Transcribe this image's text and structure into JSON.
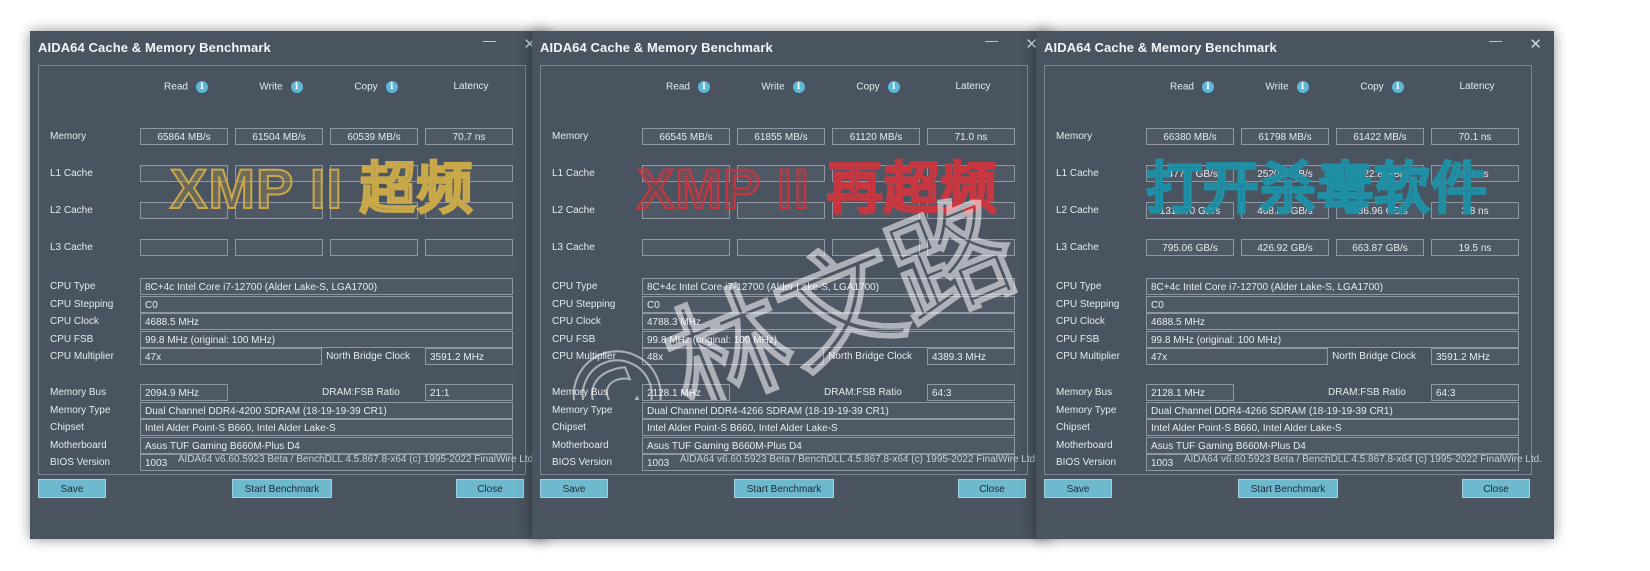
{
  "windows": [
    {
      "title": "AIDA64 Cache & Memory Benchmark",
      "overlay": "XMP II 超频",
      "headers": {
        "read": "Read",
        "write": "Write",
        "copy": "Copy",
        "latency": "Latency"
      },
      "rows": [
        {
          "label": "Memory",
          "read": "65864 MB/s",
          "write": "61504 MB/s",
          "copy": "60539 MB/s",
          "latency": "70.7 ns"
        },
        {
          "label": "L1 Cache",
          "read": "",
          "write": "",
          "copy": "",
          "latency": ""
        },
        {
          "label": "L2 Cache",
          "read": "",
          "write": "",
          "copy": "",
          "latency": ""
        },
        {
          "label": "L3 Cache",
          "read": "",
          "write": "",
          "copy": "",
          "latency": ""
        }
      ],
      "cpu_type_label": "CPU Type",
      "cpu_type": "8C+4c Intel Core i7-12700  (Alder Lake-S, LGA1700)",
      "cpu_stepping_label": "CPU Stepping",
      "cpu_stepping": "C0",
      "cpu_clock_label": "CPU Clock",
      "cpu_clock": "4688.5 MHz",
      "cpu_fsb_label": "CPU FSB",
      "cpu_fsb": "99.8 MHz  (original: 100 MHz)",
      "cpu_multiplier_label": "CPU Multiplier",
      "cpu_multiplier": "47x",
      "nb_clock_label": "North Bridge Clock",
      "nb_clock": "3591.2 MHz",
      "memory_bus_label": "Memory Bus",
      "memory_bus": "2094.9 MHz",
      "dram_ratio_label": "DRAM:FSB Ratio",
      "dram_ratio": "21:1",
      "memory_type_label": "Memory Type",
      "memory_type": "Dual Channel DDR4-4200 SDRAM  (18-19-19-39 CR1)",
      "chipset_label": "Chipset",
      "chipset": "Intel Alder Point-S B660, Intel Alder Lake-S",
      "motherboard_label": "Motherboard",
      "motherboard": "Asus TUF Gaming B660M-Plus D4",
      "bios_label": "BIOS Version",
      "bios": "1003",
      "footer": "AIDA64 v6.60.5923 Beta / BenchDLL 4.5.867.8-x64  (c) 1995-2022 FinalWire Ltd.",
      "save": "Save",
      "start": "Start Benchmark",
      "close": "Close"
    },
    {
      "title": "AIDA64 Cache & Memory Benchmark",
      "overlay": "XMP II 再超频",
      "headers": {
        "read": "Read",
        "write": "Write",
        "copy": "Copy",
        "latency": "Latency"
      },
      "rows": [
        {
          "label": "Memory",
          "read": "66545 MB/s",
          "write": "61855 MB/s",
          "copy": "61120 MB/s",
          "latency": "71.0 ns"
        },
        {
          "label": "L1 Cache",
          "read": "",
          "write": "",
          "copy": "",
          "latency": ""
        },
        {
          "label": "L2 Cache",
          "read": "",
          "write": "",
          "copy": "",
          "latency": ""
        },
        {
          "label": "L3 Cache",
          "read": "",
          "write": "",
          "copy": "",
          "latency": ""
        }
      ],
      "cpu_type_label": "CPU Type",
      "cpu_type": "8C+4c Intel Core i7-12700  (Alder Lake-S, LGA1700)",
      "cpu_stepping_label": "CPU Stepping",
      "cpu_stepping": "C0",
      "cpu_clock_label": "CPU Clock",
      "cpu_clock": "4788.3 MHz",
      "cpu_fsb_label": "CPU FSB",
      "cpu_fsb": "99.8 MHz  (original: 100 MHz)",
      "cpu_multiplier_label": "CPU Multiplier",
      "cpu_multiplier": "48x",
      "nb_clock_label": "North Bridge Clock",
      "nb_clock": "4389.3 MHz",
      "memory_bus_label": "Memory Bus",
      "memory_bus": "2128.1 MHz",
      "dram_ratio_label": "DRAM:FSB Ratio",
      "dram_ratio": "64:3",
      "memory_type_label": "Memory Type",
      "memory_type": "Dual Channel DDR4-4266 SDRAM  (18-19-19-39 CR1)",
      "chipset_label": "Chipset",
      "chipset": "Intel Alder Point-S B660, Intel Alder Lake-S",
      "motherboard_label": "Motherboard",
      "motherboard": "Asus TUF Gaming B660M-Plus D4",
      "bios_label": "BIOS Version",
      "bios": "1003",
      "footer": "AIDA64 v6.60.5923 Beta / BenchDLL 4.5.867.8-x64  (c) 1995-2022 FinalWire Ltd.",
      "save": "Save",
      "start": "Start Benchmark",
      "close": "Close"
    },
    {
      "title": "AIDA64 Cache & Memory Benchmark",
      "overlay": "打开杀毒软件",
      "headers": {
        "read": "Read",
        "write": "Write",
        "copy": "Copy",
        "latency": "Latency"
      },
      "rows": [
        {
          "label": "Memory",
          "read": "66380 MB/s",
          "write": "61798 MB/s",
          "copy": "61422 MB/s",
          "latency": "70.1 ns"
        },
        {
          "label": "L1 Cache",
          "read": "3477.7 GB/s",
          "write": "2520.9 GB/s",
          "copy": "4122.8 GB/s",
          "latency": "1.1 ns"
        },
        {
          "label": "L2 Cache",
          "read": "1311.70 GB/s",
          "write": "468.80 GB/s",
          "copy": "986.96 GB/s",
          "latency": "3.8 ns"
        },
        {
          "label": "L3 Cache",
          "read": "795.06 GB/s",
          "write": "426.92 GB/s",
          "copy": "663.87 GB/s",
          "latency": "19.5 ns"
        }
      ],
      "cpu_type_label": "CPU Type",
      "cpu_type": "8C+4c Intel Core i7-12700  (Alder Lake-S, LGA1700)",
      "cpu_stepping_label": "CPU Stepping",
      "cpu_stepping": "C0",
      "cpu_clock_label": "CPU Clock",
      "cpu_clock": "4688.5 MHz",
      "cpu_fsb_label": "CPU FSB",
      "cpu_fsb": "99.8 MHz  (original: 100 MHz)",
      "cpu_multiplier_label": "CPU Multiplier",
      "cpu_multiplier": "47x",
      "nb_clock_label": "North Bridge Clock",
      "nb_clock": "3591.2 MHz",
      "memory_bus_label": "Memory Bus",
      "memory_bus": "2128.1 MHz",
      "dram_ratio_label": "DRAM:FSB Ratio",
      "dram_ratio": "64:3",
      "memory_type_label": "Memory Type",
      "memory_type": "Dual Channel DDR4-4266 SDRAM  (18-19-19-39 CR1)",
      "chipset_label": "Chipset",
      "chipset": "Intel Alder Point-S B660, Intel Alder Lake-S",
      "motherboard_label": "Motherboard",
      "motherboard": "Asus TUF Gaming B660M-Plus D4",
      "bios_label": "BIOS Version",
      "bios": "1003",
      "footer": "AIDA64 v6.60.5923 Beta / BenchDLL 4.5.867.8-x64  (c) 1995-2022 FinalWire Ltd.",
      "save": "Save",
      "start": "Start Benchmark",
      "close": "Close"
    }
  ],
  "icons": {
    "info": "info-icon",
    "minimize": "minimize-icon",
    "close": "close-icon"
  },
  "watermark": "©林文路",
  "colors": {
    "window_bg": "#4a5360",
    "button": "#6fb9cf",
    "overlay1": "#c9a84a",
    "overlay2": "#c8363f",
    "overlay3": "#1f8fa6"
  }
}
